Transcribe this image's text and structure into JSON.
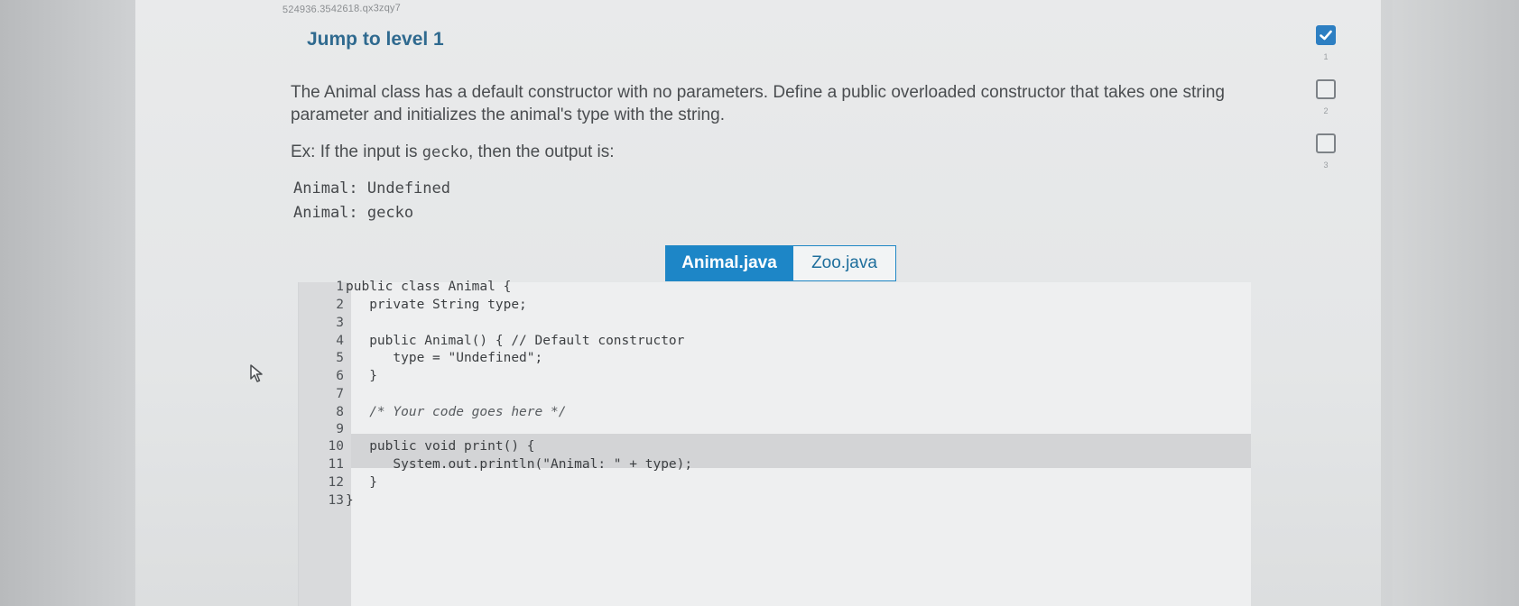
{
  "header": {
    "tiny_id": "524936.3542618.qx3zqy7",
    "title": "Jump to level 1"
  },
  "prompt": {
    "text": "The Animal class has a default constructor with no parameters. Define a public overloaded constructor that takes one string parameter and initializes the animal's type with the string.",
    "example_prefix": "Ex: If the input is ",
    "example_input": "gecko",
    "example_suffix": ", then the output is:",
    "output_lines": [
      "Animal: Undefined",
      "Animal: gecko"
    ]
  },
  "tabs": [
    {
      "label": "Animal.java",
      "active": true
    },
    {
      "label": "Zoo.java",
      "active": false
    }
  ],
  "code_lines": [
    {
      "n": "1",
      "code": "public class Animal {"
    },
    {
      "n": "2",
      "code": "   private String type;"
    },
    {
      "n": "3",
      "code": ""
    },
    {
      "n": "4",
      "code": "   public Animal() { // Default constructor"
    },
    {
      "n": "5",
      "code": "      type = \"Undefined\";"
    },
    {
      "n": "6",
      "code": "   }"
    },
    {
      "n": "7",
      "code": ""
    },
    {
      "n": "8",
      "code": "   /* Your code goes here */"
    },
    {
      "n": "9",
      "code": ""
    },
    {
      "n": "10",
      "code": "   public void print() {"
    },
    {
      "n": "11",
      "code": "      System.out.println(\"Animal: \" + type);"
    },
    {
      "n": "12",
      "code": "   }"
    },
    {
      "n": "13",
      "code": "}"
    }
  ],
  "levels": [
    {
      "number": "1",
      "completed": true
    },
    {
      "number": "2",
      "completed": false
    },
    {
      "number": "3",
      "completed": false
    }
  ],
  "icons": {
    "cursor": "mouse-pointer-icon",
    "check": "checkmark-icon"
  },
  "colors": {
    "accent": "#1d86c7",
    "title": "#2f6a8f"
  }
}
